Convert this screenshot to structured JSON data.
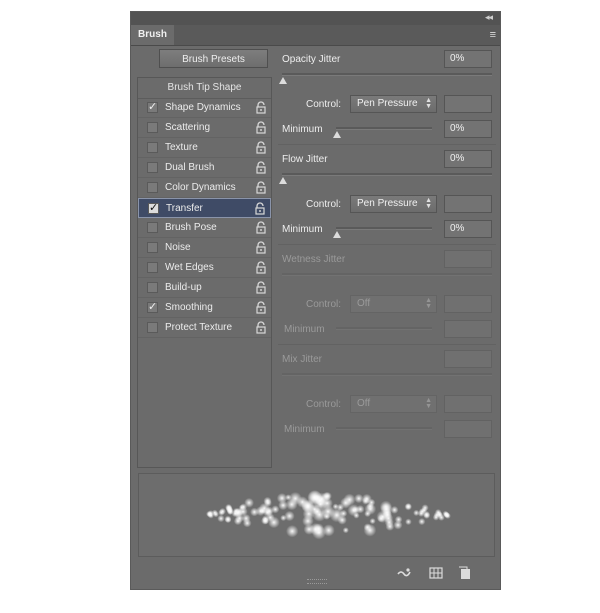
{
  "panel": {
    "tab_label": "Brush",
    "collapse_glyph": "◂◂",
    "menu_glyph": "≡",
    "presets_button": "Brush Presets"
  },
  "options": {
    "header": "Brush Tip Shape",
    "items": [
      {
        "label": "Shape Dynamics",
        "checked": true
      },
      {
        "label": "Scattering",
        "checked": false
      },
      {
        "label": "Texture",
        "checked": false
      },
      {
        "label": "Dual Brush",
        "checked": false
      },
      {
        "label": "Color Dynamics",
        "checked": false
      },
      {
        "label": "Transfer",
        "checked": true,
        "selected": true
      },
      {
        "label": "Brush Pose",
        "checked": false
      },
      {
        "label": "Noise",
        "checked": false
      },
      {
        "label": "Wet Edges",
        "checked": false
      },
      {
        "label": "Build-up",
        "checked": false
      },
      {
        "label": "Smoothing",
        "checked": true
      },
      {
        "label": "Protect Texture",
        "checked": false
      }
    ]
  },
  "transfer": {
    "opacity_jitter": {
      "label": "Opacity Jitter",
      "value": "0%"
    },
    "opacity_control": {
      "label": "Control:",
      "value": "Pen Pressure"
    },
    "opacity_minimum": {
      "label": "Minimum",
      "value": "0%"
    },
    "flow_jitter": {
      "label": "Flow Jitter",
      "value": "0%"
    },
    "flow_control": {
      "label": "Control:",
      "value": "Pen Pressure"
    },
    "flow_minimum": {
      "label": "Minimum",
      "value": "0%"
    },
    "wetness_jitter": {
      "label": "Wetness Jitter",
      "value": ""
    },
    "wetness_control": {
      "label": "Control:",
      "value": "Off"
    },
    "wetness_minimum": {
      "label": "Minimum",
      "value": ""
    },
    "mix_jitter": {
      "label": "Mix Jitter",
      "value": ""
    },
    "mix_control": {
      "label": "Control:",
      "value": "Off"
    },
    "mix_minimum": {
      "label": "Minimum",
      "value": ""
    }
  },
  "footer": {
    "icons": [
      "brush-visibility-icon",
      "grid-icon",
      "new-preset-icon"
    ]
  },
  "colors": {
    "panel_bg": "#6b6b6b",
    "selected_row": "#3f4b66",
    "text": "#eeeeee",
    "dim_text": "#9a9a9a"
  }
}
